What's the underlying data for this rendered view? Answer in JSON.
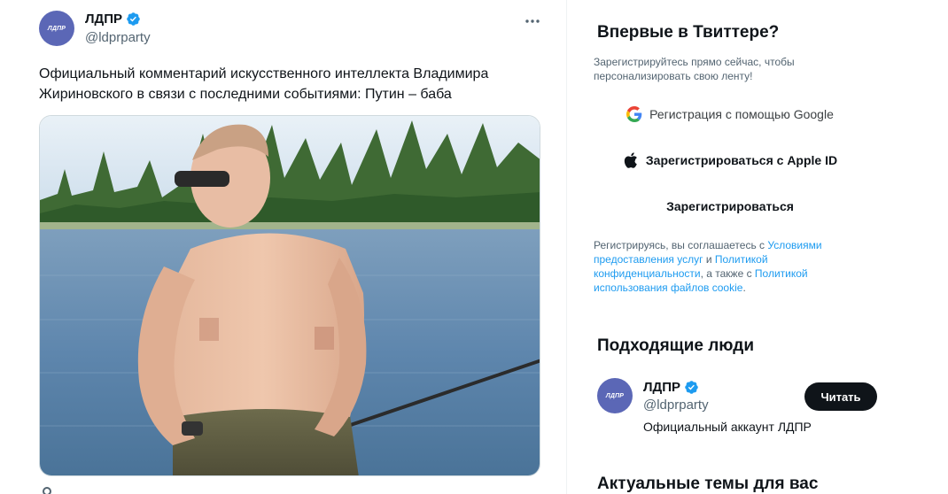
{
  "tweet": {
    "author": {
      "avatar_text": "ЛДПР",
      "display_name": "ЛДПР",
      "handle": "@ldprparty",
      "verified": true
    },
    "more_icon": "more-dots-icon",
    "text": "Официальный комментарий искусственного интеллекта Владимира Жириновского в связи с последними событиями: Путин – баба"
  },
  "signup": {
    "title": "Впервые в Твиттере?",
    "subtitle": "Зарегистрируйтесь прямо сейчас, чтобы персонализировать свою ленту!",
    "google_label": "Регистрация с помощью Google",
    "apple_label": "Зарегистрироваться с Apple ID",
    "register_label": "Зарегистрироваться",
    "terms": {
      "part1": "Регистрируясь, вы соглашаетесь с ",
      "link1": "Условиями предоставления услуг",
      "part2": " и ",
      "link2": "Политикой конфиденциальности",
      "part3": ", а также с ",
      "link3": "Политикой использования файлов cookie",
      "part4": "."
    }
  },
  "who_to_follow": {
    "title": "Подходящие люди",
    "person": {
      "avatar_text": "ЛДПР",
      "display_name": "ЛДПР",
      "handle": "@ldprparty",
      "bio": "Официальный аккаунт ЛДПР",
      "follow_label": "Читать"
    }
  },
  "trends": {
    "title": "Актуальные темы для вас"
  },
  "colors": {
    "link": "#1d9bf0",
    "verified": "#1d9bf0",
    "text_secondary": "#536471",
    "avatar_bg": "#5b67b6",
    "follow_bg": "#0f1419"
  }
}
